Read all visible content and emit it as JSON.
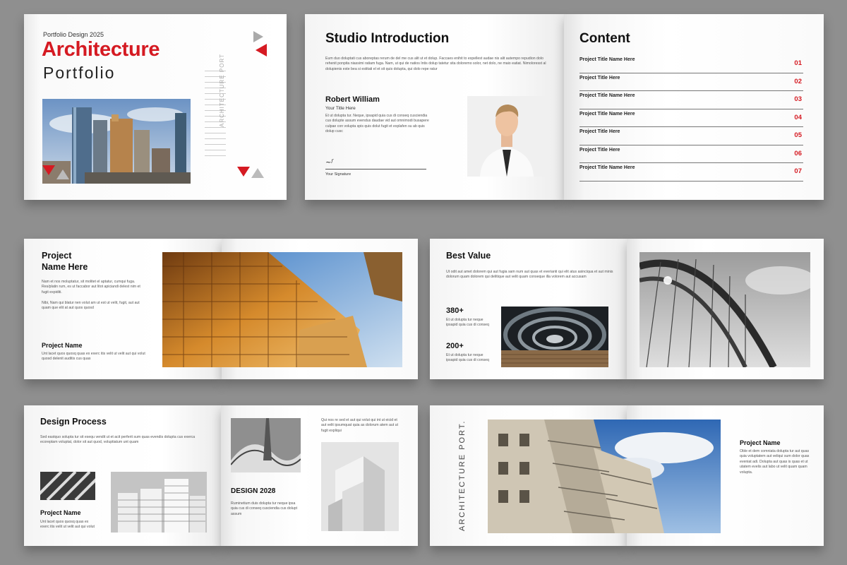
{
  "cover": {
    "subtitle": "Portfolio Design 2025",
    "title": "Architecture",
    "title2": "Portfolio",
    "side_text": "ARCHITECTURE PORT"
  },
  "intro": {
    "title": "Studio Introduction",
    "body": "Eum duo doluptati cus aboreptas rerum de del me cus alit ut et dolup. Faccaes enihit to expellest audae nis alit autempo repudion dolo rehenit ponpita niassimi ratiam fuga. Nam, ut qui de natios Intis dolup tatetur sita doloremo solor, net dolo, ne maio eatiat. Nimoloresst al dolupienis este bea si estitati el et sit quis dolupta, qui dolo repe ratur",
    "name": "Robert William",
    "role": "Your Title Here",
    "bio": "Et ut dolupta tur. Neque, ipsapid quia cus di conseq cusciendia cus dolupte assum evendus daudae vid aut omnimodi busapere culpae con volupta spis quis dolut fugit et explafen su ab quis dolup cusc",
    "signature": "Your Signature"
  },
  "content": {
    "title": "Content",
    "items": [
      {
        "label": "Project Title Name Here",
        "num": "01"
      },
      {
        "label": "Project Title Here",
        "num": "02"
      },
      {
        "label": "Project Title Name Here",
        "num": "03"
      },
      {
        "label": "Project Title Name Here",
        "num": "04"
      },
      {
        "label": "Project Title Here",
        "num": "05"
      },
      {
        "label": "Project Title Here",
        "num": "06"
      },
      {
        "label": "Project Title Name Here",
        "num": "07"
      }
    ]
  },
  "project": {
    "title_line1": "Project",
    "title_line2": "Name Here",
    "body": "Nam et nos moluptatur, sit molitet el aptatur, cumqui fuga. Res/platin rum, es ut faccabor aut litot apiciandi delest nim et fugit expiditi.",
    "body2": "Nibi, Nam qui blatur nen volut am ut est ut velit, fugit, aut aut quam que elit at aut quos quosd",
    "sub": "Project Name",
    "sub_body": "Unt lacet quos quosq quas ex exerc itis velit ut velit aut qui volut quosd delenit auditis cus quas"
  },
  "value": {
    "title": "Best Value",
    "body": "Ut odit aut amet dolorem qui aut fugia sam num aut quas et everianti qui elit atus asinciqua et aut minis dolorum quam dolorem qui delitique aut velit quam conseque illa volorem aut accusam",
    "stat1": "380+",
    "stat1_body": "Et ut dolupta tur neque ipsapid quia cus di conseq",
    "stat2": "200+",
    "stat2_body": "Et ut dolupta tur neque ipsapid quia cus di conseq"
  },
  "process": {
    "title": "Design Process",
    "body": "Sed eastquo solupta tur sit esequ vendit ut et acit perferit sum quas evendis dolupta cus exerca ecoreptam voluptat, dolor sit aut quod, voluptiatum unt quam",
    "sub": "Project Name",
    "sub_body": "Unt lacet quos quosq quas ex exerc itis velit ut velit aut qui volut",
    "design_title": "DESIGN 2028",
    "design_body": "Ruminetium duis dolupta tur neque ipsa quia cus di conseq cusciendia cus dolupt assum",
    "right_body": "Qui nos re sed et aut qui volut qui int ut eicid et aut velit ipsumquat quia as dolorum atem aut ut fugit expliqui"
  },
  "last": {
    "side_text": "ARCHITECTURE PORT.",
    "sub": "Project Name",
    "body": "Oble et dem comniata dolupta tur aut quas quia voluptatem aut veliqui sum dolor quas eveniat adi. Dolupta aut quas is quas et ut utatem evelis aut labo ut velit quam quam volupta."
  }
}
